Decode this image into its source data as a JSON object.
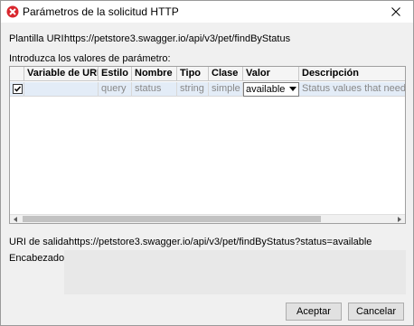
{
  "window": {
    "title": "Parámetros de la solicitud HTTP",
    "close_icon": "close-icon",
    "app_icon": "xmlspy-icon"
  },
  "uri_template": {
    "label": "Plantilla URI:",
    "value": "https://petstore3.swagger.io/api/v3/pet/findByStatus"
  },
  "params": {
    "label": "Introduzca los valores de parámetro:",
    "columns": [
      "Variable de URI",
      "Estilo",
      "Nombre",
      "Tipo",
      "Clase",
      "Valor",
      "Descripción"
    ],
    "rows": [
      {
        "checked": true,
        "uri_variable": "",
        "style": "query",
        "name": "status",
        "type": "string",
        "class": "simple",
        "value": "available",
        "description": "Status values that need to b"
      }
    ]
  },
  "output_uri": {
    "label": "URI de salida:",
    "value": "https://petstore3.swagger.io/api/v3/pet/findByStatus?status=available"
  },
  "headers": {
    "label": "Encabezados:"
  },
  "buttons": {
    "accept": "Aceptar",
    "cancel": "Cancelar"
  }
}
